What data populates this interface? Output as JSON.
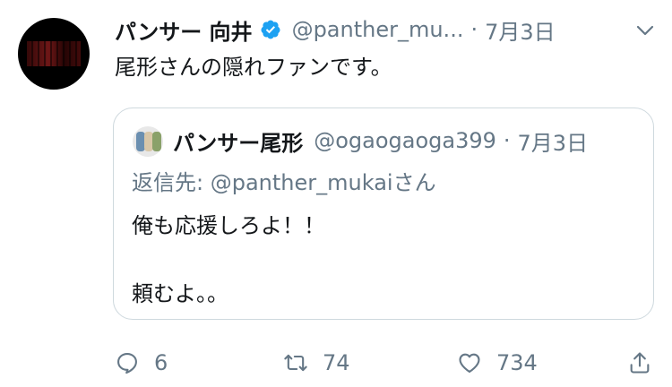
{
  "tweet": {
    "author_name": "パンサー 向井",
    "handle": "@panther_mu...",
    "separator": "·",
    "date": "7月3日",
    "text": "尾形さんの隠れファンです。"
  },
  "quoted_tweet": {
    "author_name": "パンサー尾形",
    "handle": "@ogaogaoga399",
    "separator": "·",
    "date": "7月3日",
    "reply_label": "返信先: ",
    "reply_mention": "@panther_mukai",
    "reply_suffix": "さん",
    "line1": "俺も応援しろよ！！",
    "line2": "頼むよ。。"
  },
  "actions": {
    "reply_count": "6",
    "retweet_count": "74",
    "like_count": "734"
  },
  "colors": {
    "verified": "#1da1f2",
    "muted": "#657786",
    "border": "#cfd9de"
  }
}
